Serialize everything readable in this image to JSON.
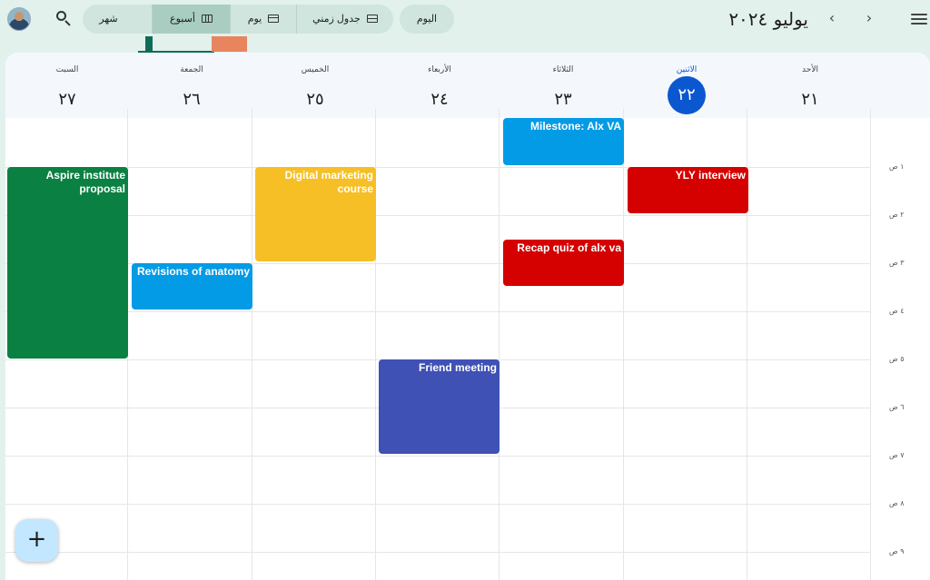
{
  "header": {
    "title": "يوليو ٢٠٢٤",
    "today_label": "اليوم",
    "views": [
      {
        "label": "جدول زمني",
        "icon": "schedule-view-icon",
        "active": false
      },
      {
        "label": "يوم",
        "icon": "day-view-icon",
        "active": false
      },
      {
        "label": "أسبوع",
        "icon": "week-view-icon",
        "active": true
      },
      {
        "label": "شهر",
        "icon": "month-view-icon",
        "active": false
      }
    ],
    "prev_glyph": "‹",
    "next_glyph": "›"
  },
  "days": [
    {
      "name": "الأحد",
      "number": "٢١",
      "current": false
    },
    {
      "name": "الاثنين",
      "number": "٢٢",
      "current": true
    },
    {
      "name": "الثلاثاء",
      "number": "٢٣",
      "current": false
    },
    {
      "name": "الأربعاء",
      "number": "٢٤",
      "current": false
    },
    {
      "name": "الخميس",
      "number": "٢٥",
      "current": false
    },
    {
      "name": "الجمعة",
      "number": "٢٦",
      "current": false
    },
    {
      "name": "السبت",
      "number": "٢٧",
      "current": false
    }
  ],
  "time_labels": [
    "١ ص",
    "٢ ص",
    "٣ ص",
    "٤ ص",
    "٥ ص",
    "٦ ص",
    "٧ ص",
    "٨ ص",
    "٩ ص"
  ],
  "events": [
    {
      "title": "Milestone: Alx VA",
      "day": "الثلاثاء",
      "color": "#039be5"
    },
    {
      "title": "YLY interview",
      "day": "الاثنين",
      "color": "#d50000"
    },
    {
      "title": "Recap quiz of alx va",
      "day": "الثلاثاء",
      "color": "#d50000"
    },
    {
      "title": "Digital marketing course",
      "day": "الخميس",
      "color": "#f6bf26"
    },
    {
      "title": "Aspire institute proposal",
      "day": "السبت",
      "color": "#0b8043"
    },
    {
      "title": "Revisions of anatomy",
      "day": "الجمعة",
      "color": "#039be5"
    },
    {
      "title": "Friend meeting",
      "day": "الأربعاء",
      "color": "#3f51b5"
    }
  ],
  "fab_label": "+",
  "colors": {
    "accent": "#0b57d0",
    "background": "#e2f1ec"
  }
}
